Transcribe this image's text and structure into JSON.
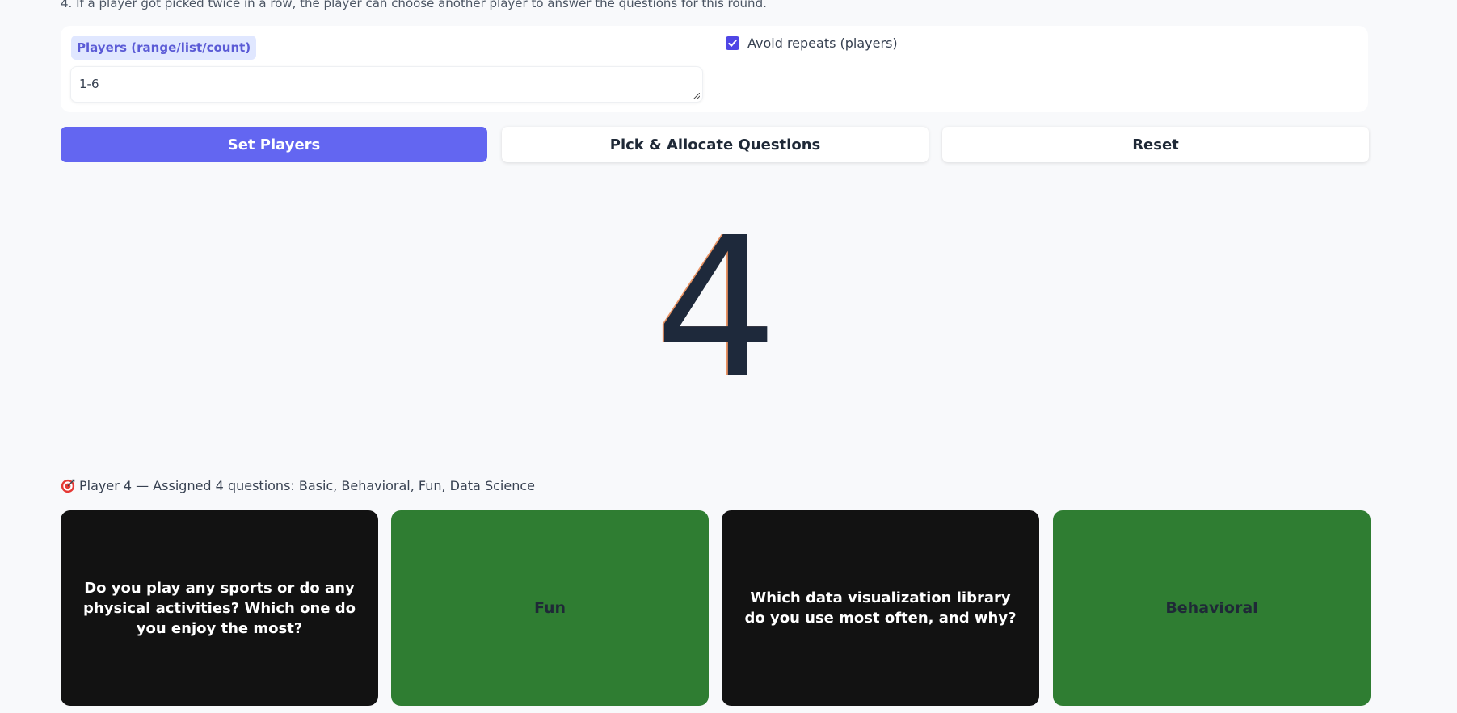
{
  "instructions": {
    "rule_4": "4. If a player got picked twice in a row, the player can choose another player to answer the questions for this round."
  },
  "settings": {
    "players_label": "Players (range/list/count)",
    "players_value": "1-6",
    "avoid_repeats_label": "Avoid repeats (players)",
    "avoid_repeats_checked": true
  },
  "buttons": {
    "set_players": "Set Players",
    "pick_allocate": "Pick & Allocate Questions",
    "reset": "Reset"
  },
  "picked_number": "4",
  "result": {
    "icon": "target-icon",
    "text": "Player 4 — Assigned 4 questions: Basic, Behavioral, Fun, Data Science"
  },
  "cards": [
    {
      "text": "Do you play any sports or do any physical activities? Which one do you enjoy the most?",
      "style": "revealed"
    },
    {
      "text": "Fun",
      "style": "category"
    },
    {
      "text": "Which data visualization library do you use most often, and why?",
      "style": "revealed"
    },
    {
      "text": "Behavioral",
      "style": "category"
    }
  ],
  "colors": {
    "accent": "#6366f1",
    "card_dark": "#121212",
    "card_green": "#2f7d32",
    "label_bg": "#e0e7ff"
  }
}
